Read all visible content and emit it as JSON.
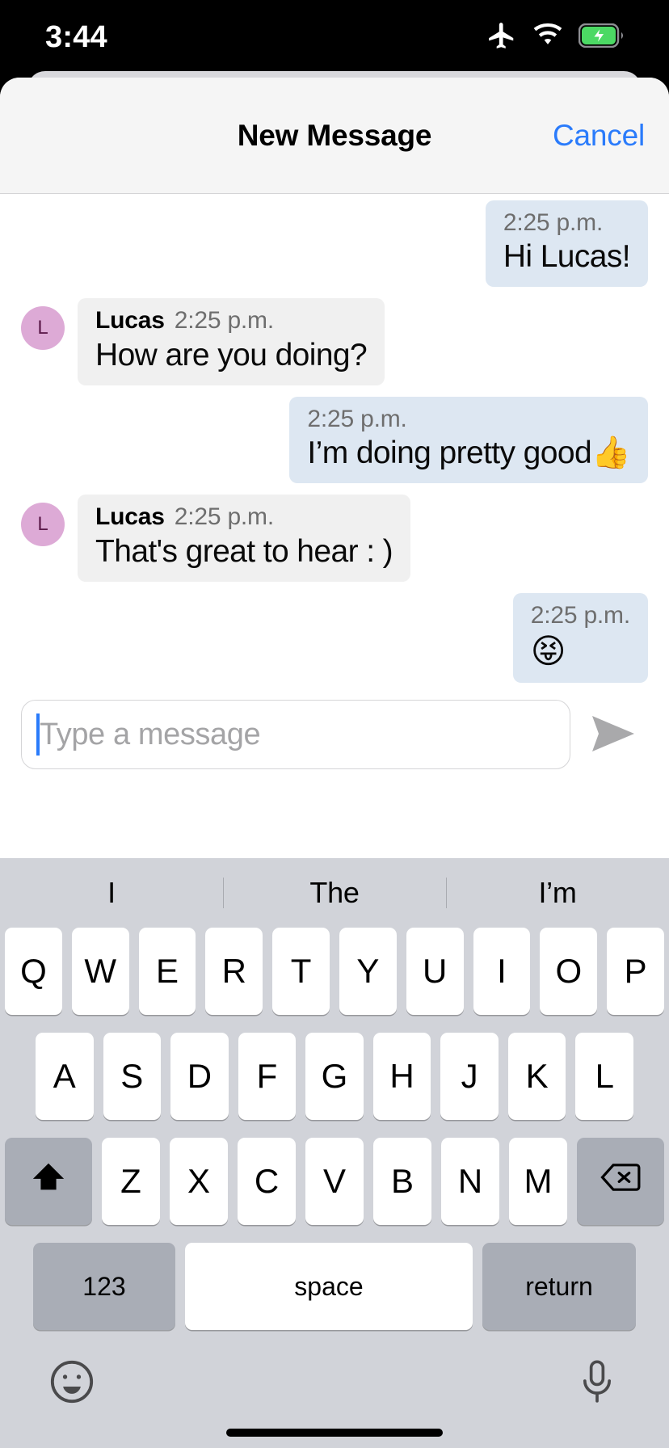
{
  "status_bar": {
    "time": "3:44",
    "icons": [
      "airplane-mode-icon",
      "wifi-icon",
      "battery-charging-icon"
    ],
    "battery_color": "#4cd964"
  },
  "sheet": {
    "title": "New Message",
    "cancel_label": "Cancel",
    "accent_color": "#2a7bfb"
  },
  "conversation": {
    "messages": [
      {
        "direction": "outgoing",
        "sender": "",
        "time": "2:25 p.m.",
        "text": "Hi Lucas!",
        "avatar": ""
      },
      {
        "direction": "incoming",
        "sender": "Lucas",
        "time": "2:25 p.m.",
        "text": "How are you doing?",
        "avatar": "L"
      },
      {
        "direction": "outgoing",
        "sender": "",
        "time": "2:25 p.m.",
        "text": "I’m doing pretty good👍",
        "avatar": ""
      },
      {
        "direction": "incoming",
        "sender": "Lucas",
        "time": "2:25 p.m.",
        "text": "That's great to hear : )",
        "avatar": "L"
      },
      {
        "direction": "outgoing",
        "sender": "",
        "time": "2:25 p.m.",
        "text": "😝",
        "avatar": ""
      }
    ],
    "outgoing_bubble_color": "#dde7f2",
    "incoming_bubble_color": "#f0f0f0",
    "avatar_color": "#ddaad6"
  },
  "composer": {
    "placeholder": "Type a message",
    "value": "",
    "send_icon": "send-paper-plane-icon"
  },
  "keyboard": {
    "suggestions": [
      "I",
      "The",
      "I’m"
    ],
    "row1": [
      "Q",
      "W",
      "E",
      "R",
      "T",
      "Y",
      "U",
      "I",
      "O",
      "P"
    ],
    "row2": [
      "A",
      "S",
      "D",
      "F",
      "G",
      "H",
      "J",
      "K",
      "L"
    ],
    "row3": [
      "Z",
      "X",
      "C",
      "V",
      "B",
      "N",
      "M"
    ],
    "shift_label": "shift-icon",
    "backspace_label": "backspace-icon",
    "numbers_label": "123",
    "space_label": "space",
    "return_label": "return",
    "emoji_label": "emoji-icon",
    "dictation_label": "microphone-icon"
  }
}
